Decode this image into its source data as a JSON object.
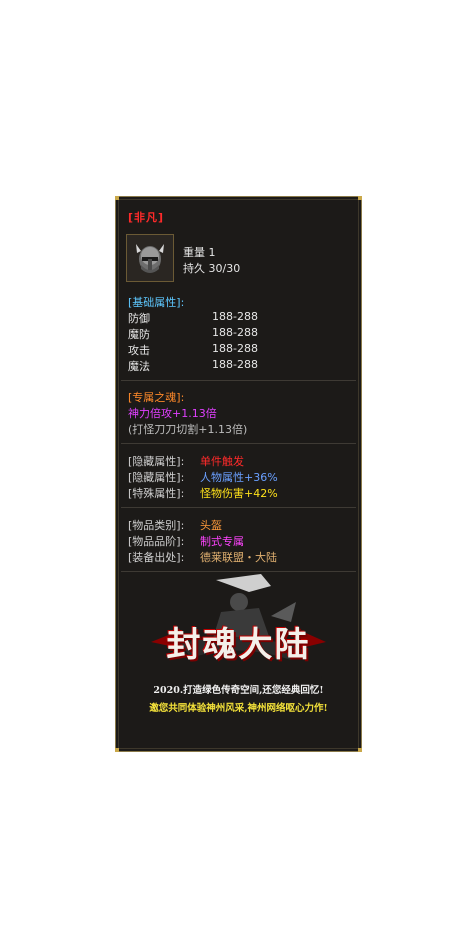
{
  "item": {
    "name": "[非凡]",
    "icon": "helmet-icon",
    "weight_label": "重量 1",
    "durability_label": "持久 30/30"
  },
  "base_attrs": {
    "heading": "[基础属性]:",
    "rows": [
      {
        "label": "防御",
        "value": "188-288"
      },
      {
        "label": "魔防",
        "value": "188-288"
      },
      {
        "label": "攻击",
        "value": "188-288"
      },
      {
        "label": "魔法",
        "value": "188-288"
      }
    ]
  },
  "soul": {
    "heading": "[专属之魂]:",
    "line1": "神力倍攻+1.13倍",
    "line2": "(打怪刀刀切割+1.13倍)"
  },
  "hidden": {
    "rows": [
      {
        "label": "[隐藏属性]:",
        "value": "单件触发",
        "extra": ""
      },
      {
        "label": "[隐藏属性]:",
        "value": "人物属性",
        "extra": "+36%"
      },
      {
        "label": "[特殊属性]:",
        "value": "怪物伤害",
        "extra": "+42%"
      }
    ]
  },
  "meta": {
    "rows": [
      {
        "label": "[物品类别]:",
        "value": "头盔"
      },
      {
        "label": "[物品品阶]:",
        "value": "制式专属"
      },
      {
        "label": "[装备出处]:",
        "value": "德莱联盟・大陆"
      }
    ]
  },
  "banner": {
    "logo": "封魂大陆",
    "line1": "2020.打造绿色传奇空间,还您经典回忆!",
    "line2": "邀您共同体验神州风采,神州网络呕心力作!"
  },
  "colors": {
    "panel_bg": "#1c1a18",
    "border": "#8a7a4a",
    "title_red": "#ff2a2a",
    "heading_blue": "#5ec8ff",
    "magenta": "#e040ff"
  }
}
